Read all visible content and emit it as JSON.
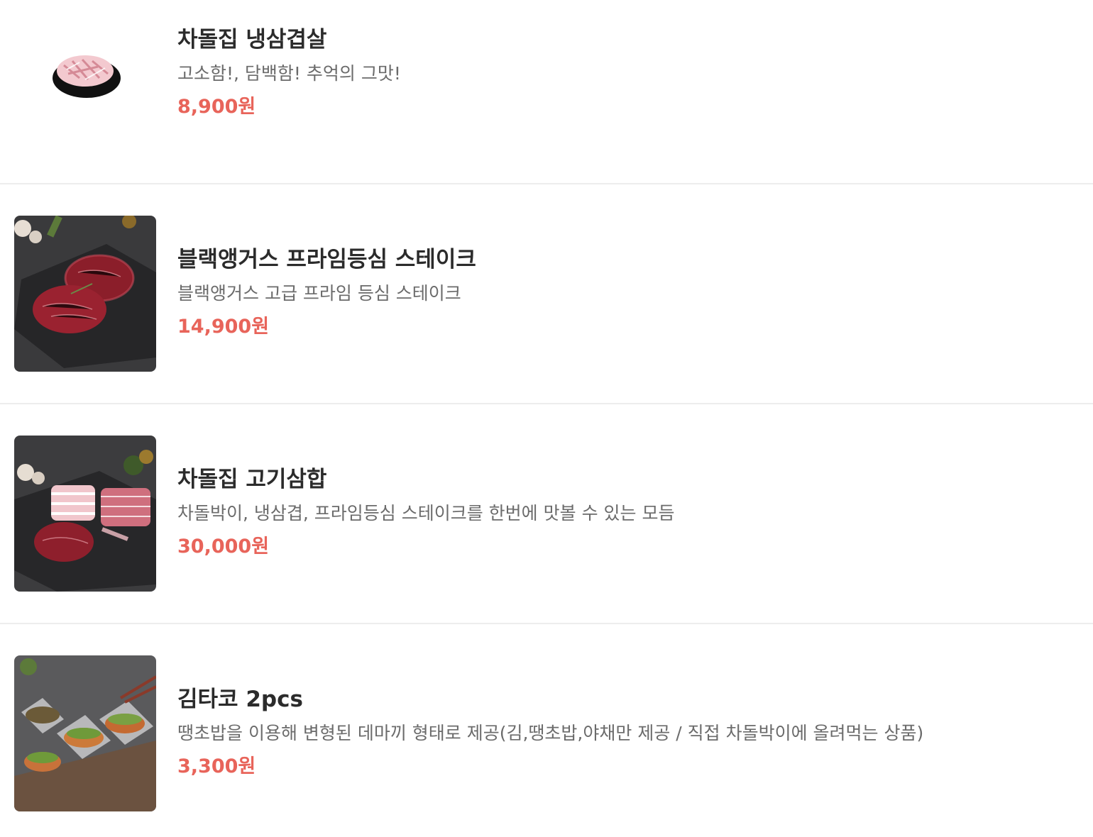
{
  "colors": {
    "name": "#2b2b2b",
    "description": "#6b6b6b",
    "price": "#e8645a",
    "divider": "#ededed"
  },
  "menu_items": [
    {
      "name": "차돌집 냉삼겹살",
      "description": "고소함!, 담백함! 추억의 그맛!",
      "price": "8,900원",
      "image": "sliced-pork-belly-plate"
    },
    {
      "name": "블랙앵거스 프라임등심 스테이크",
      "description": "블랙앵거스 고급 프라임 등심 스테이크",
      "price": "14,900원",
      "image": "steak-on-slate"
    },
    {
      "name": "차돌집 고기삼합",
      "description": "차돌박이, 냉삼겹, 프라임등심 스테이크를 한번에 맛볼 수 있는 모듬",
      "price": "30,000원",
      "image": "meat-combo-on-slate"
    },
    {
      "name": "김타코 2pcs",
      "description": "땡초밥을 이용해 변형된 데마끼 형태로 제공(김,땡초밥,야채만 제공 / 직접 차돌박이에 올려먹는 상품)",
      "price": "3,300원",
      "image": "seaweed-taco-tray"
    }
  ]
}
